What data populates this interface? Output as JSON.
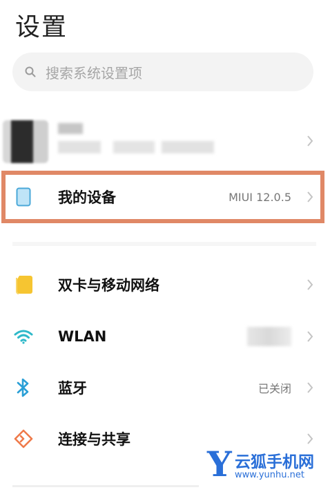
{
  "page": {
    "title": "设置"
  },
  "search": {
    "placeholder": "搜索系统设置项"
  },
  "my_device": {
    "label": "我的设备",
    "value": "MIUI 12.0.5"
  },
  "items": [
    {
      "label": "双卡与移动网络",
      "icon": "sim-card-icon",
      "color": "#f6c531"
    },
    {
      "label": "WLAN",
      "icon": "wifi-icon",
      "color": "#2fb9c9"
    },
    {
      "label": "蓝牙",
      "icon": "bluetooth-icon",
      "value": "已关闭",
      "color": "#2a9fd6"
    },
    {
      "label": "连接与共享",
      "icon": "connection-share-icon",
      "color": "#ef7a4a"
    }
  ],
  "watermark": {
    "logo_letter": "Y",
    "name": "云狐手机网",
    "url": "www.yunhu.net"
  },
  "colors": {
    "highlight": "#e08866",
    "watermark": "#2a6fd8"
  }
}
